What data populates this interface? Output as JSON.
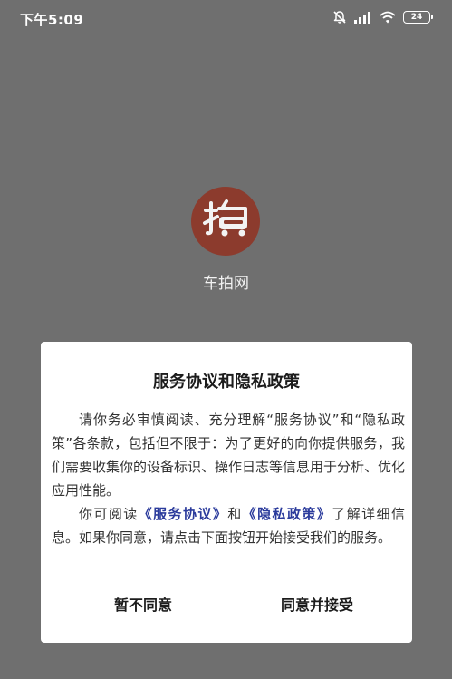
{
  "status_bar": {
    "time": "下午5:09",
    "icons": [
      "mute-icon",
      "signal-icon",
      "wifi-icon",
      "battery-icon"
    ],
    "battery_level": "24"
  },
  "app": {
    "name": "车拍网",
    "logo_char": "拍",
    "logo_color": "#8c3b2d"
  },
  "dialog": {
    "title": "服务协议和隐私政策",
    "body": {
      "p1": "请你务必审慎阅读、充分理解“服务协议”和“隐私政策”各条款，包括但不限于：为了更好的向你提供服务，我们需要收集你的设备标识、操作日志等信息用于分析、优化应用性能。",
      "p2_prefix": "你可阅读",
      "service_link": "《服务协议》",
      "p2_and": "和",
      "privacy_link": "《隐私政策》",
      "p2_suffix": "了解详细信息。如果你同意，请点击下面按钮开始接受我们的服务。"
    },
    "disagree_label": "暂不同意",
    "agree_label": "同意并接受",
    "link_color": "#2b3b9c"
  }
}
